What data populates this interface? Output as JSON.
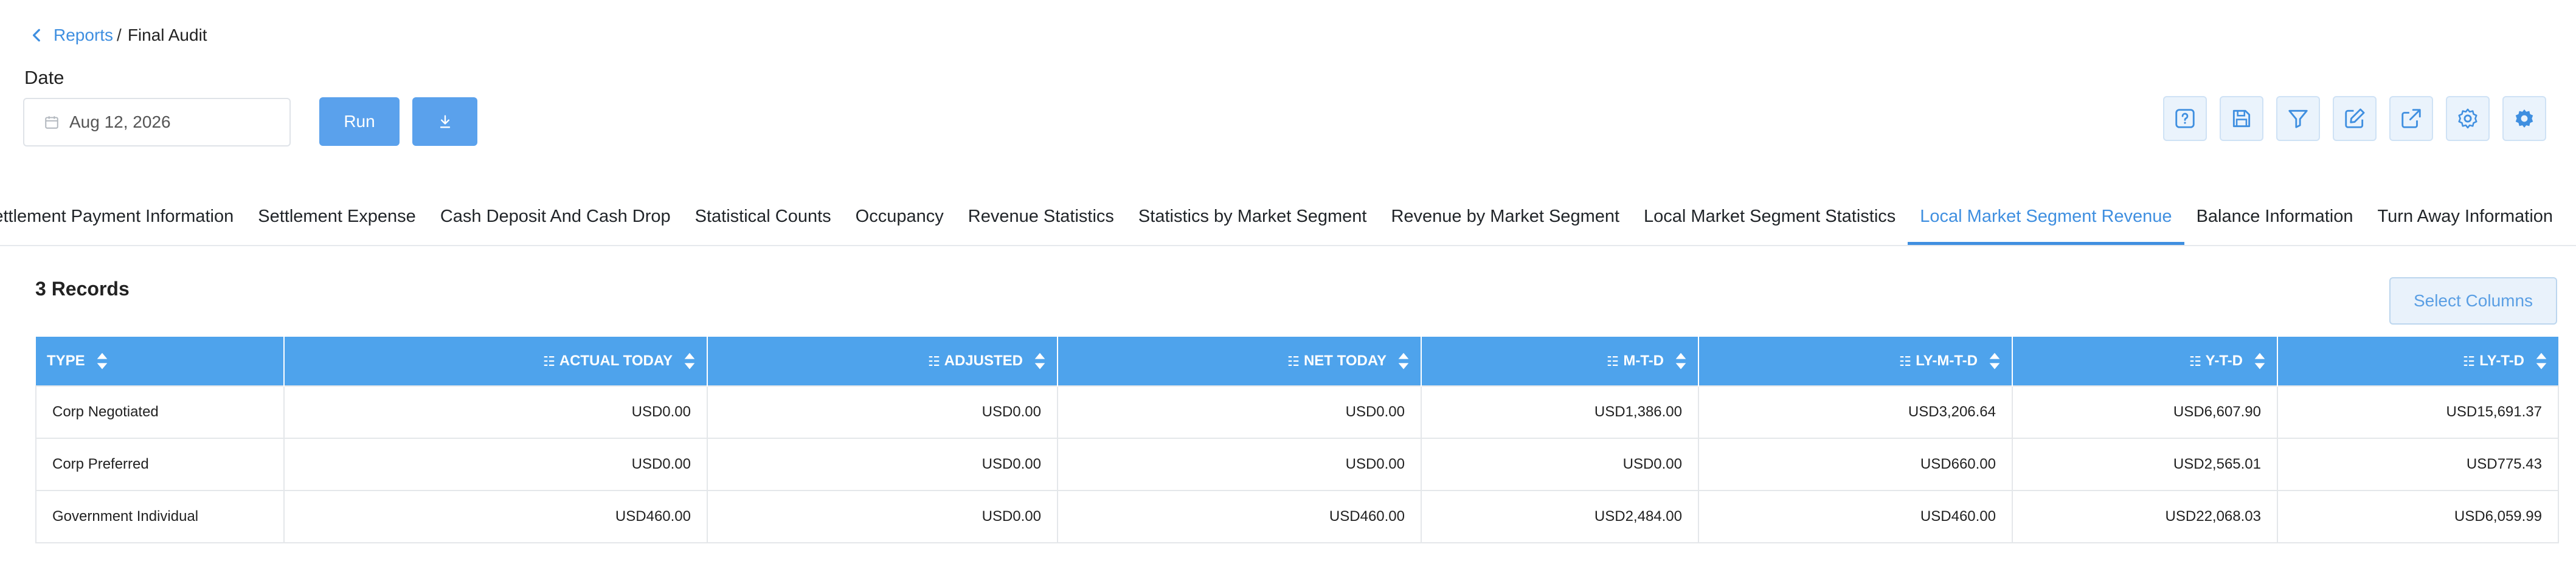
{
  "breadcrumb": {
    "parent": "Reports",
    "separator": "/",
    "current": "Final Audit"
  },
  "filter": {
    "date_label": "Date",
    "date_value": "Aug 12, 2026",
    "run_label": "Run"
  },
  "toolbar": {
    "icons": [
      "help-icon",
      "save-icon",
      "filter-icon",
      "edit-icon",
      "external-link-icon",
      "settings-icon",
      "advanced-settings-icon"
    ]
  },
  "tabs": [
    "Settlement Payment Information",
    "Settlement Expense",
    "Cash Deposit And Cash Drop",
    "Statistical Counts",
    "Occupancy",
    "Revenue Statistics",
    "Statistics by Market Segment",
    "Revenue by Market Segment",
    "Local Market Segment Statistics",
    "Local Market Segment Revenue",
    "Balance Information",
    "Turn Away Information"
  ],
  "active_tab": "Local Market Segment Revenue",
  "records": {
    "count_label": "3 Records",
    "select_columns_label": "Select Columns"
  },
  "table": {
    "columns": [
      "TYPE",
      "ACTUAL TODAY",
      "ADJUSTED",
      "NET TODAY",
      "M-T-D",
      "LY-M-T-D",
      "Y-T-D",
      "LY-T-D"
    ],
    "rows": [
      [
        "Corp Negotiated",
        "USD0.00",
        "USD0.00",
        "USD0.00",
        "USD1,386.00",
        "USD3,206.64",
        "USD6,607.90",
        "USD15,691.37"
      ],
      [
        "Corp Preferred",
        "USD0.00",
        "USD0.00",
        "USD0.00",
        "USD0.00",
        "USD660.00",
        "USD2,565.01",
        "USD775.43"
      ],
      [
        "Government Individual",
        "USD460.00",
        "USD0.00",
        "USD460.00",
        "USD2,484.00",
        "USD460.00",
        "USD22,068.03",
        "USD6,059.99"
      ]
    ]
  },
  "colors": {
    "accent": "#4ea3ec",
    "link": "#3f8fe0",
    "button": "#5aa1ec"
  }
}
